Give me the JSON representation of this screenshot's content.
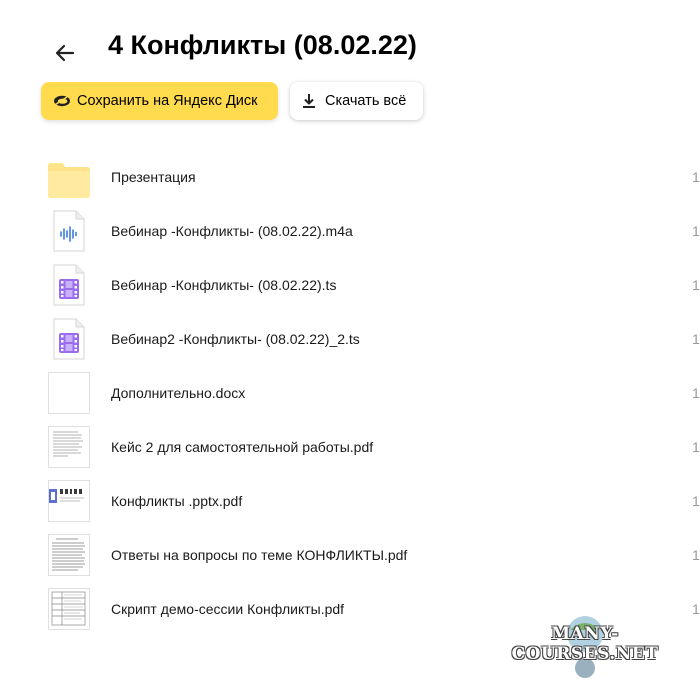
{
  "header": {
    "title": "4 Конфликты (08.02.22)",
    "back_icon": "arrow-left-icon"
  },
  "toolbar": {
    "save_label": "Сохранить на Яндекс Диск",
    "save_icon": "yandex-disk-icon",
    "download_label": "Скачать всё",
    "download_icon": "download-icon"
  },
  "colors": {
    "accent": "#ffdb4d",
    "folder": "#ffe38a",
    "video": "#9b6cf0",
    "audio": "#3d7be0"
  },
  "files": [
    {
      "name": "Презентация",
      "date": "1",
      "icon": "folder-icon"
    },
    {
      "name": "Вебинар -Конфликты- (08.02.22).m4a",
      "date": "1",
      "icon": "audio-file-icon"
    },
    {
      "name": "Вебинар -Конфликты- (08.02.22).ts",
      "date": "1",
      "icon": "video-file-icon"
    },
    {
      "name": "Вебинар2 -Конфликты- (08.02.22)_2.ts",
      "date": "1",
      "icon": "video-file-icon"
    },
    {
      "name": "Дополнительно.docx",
      "date": "1",
      "icon": "document-thumbnail-icon"
    },
    {
      "name": "Кейс 2 для самостоятельной работы.pdf",
      "date": "1",
      "icon": "pdf-thumbnail-icon"
    },
    {
      "name": "Конфликты .pptx.pdf",
      "date": "1",
      "icon": "pdf-thumbnail-icon"
    },
    {
      "name": "Ответы на вопросы по теме КОНФЛИКТЫ.pdf",
      "date": "1",
      "icon": "pdf-thumbnail-icon"
    },
    {
      "name": "Скрипт демо-сессии Конфликты.pdf",
      "date": "1",
      "icon": "pdf-thumbnail-icon"
    }
  ],
  "watermark": {
    "text": "MANY-COURSES.NET"
  }
}
